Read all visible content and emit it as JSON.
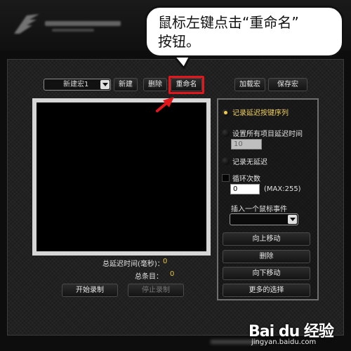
{
  "toolbar": {
    "macro_select_value": "新建宏1",
    "new_label": "新建",
    "delete_label": "删除",
    "rename_label": "重命名",
    "load_label": "加载宏",
    "save_label": "保存宏"
  },
  "editor": {
    "total_delay_label": "总延迟时间(毫秒)：",
    "total_delay_value": "0",
    "total_items_label": "总条目：",
    "total_items_value": "0",
    "start_record_label": "开始录制",
    "stop_record_label": "停止录制"
  },
  "options": {
    "record_delay_label": "记录延迟按键序列",
    "set_delay_label": "设置所有项目延迟时间",
    "set_delay_value": "10",
    "no_delay_label": "记录无延迟",
    "loop_label": "循环次数",
    "loop_value": "0",
    "loop_max_label": "(MAX:255)",
    "insert_mouse_label": "插入一个鼠标事件",
    "move_up_label": "向上移动",
    "delete_label": "删除",
    "move_down_label": "向下移动",
    "more_label": "更多的选择"
  },
  "callout": {
    "line1": "鼠标左键点击“重命名”",
    "line2": "按钮。"
  },
  "watermark": {
    "logo": "Bai du 经验",
    "url": "jingyan.baidu.com"
  },
  "colors": {
    "highlight": "#e3161b",
    "accent": "#f0c94a"
  }
}
